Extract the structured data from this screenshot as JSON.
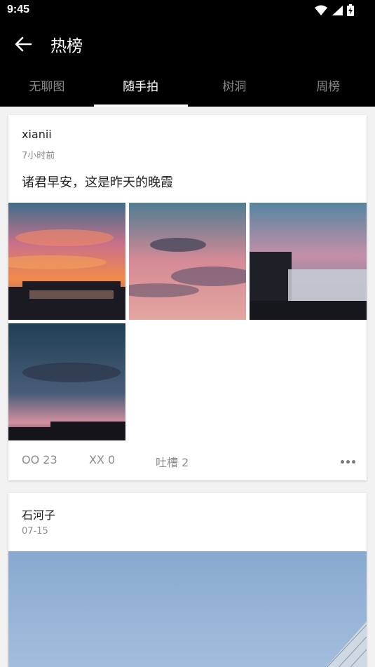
{
  "status": {
    "time": "9:45"
  },
  "appbar": {
    "title": "热榜"
  },
  "tabs": [
    {
      "label": "无聊图"
    },
    {
      "label": "随手拍"
    },
    {
      "label": "树洞"
    },
    {
      "label": "周榜"
    }
  ],
  "posts": [
    {
      "author": "xianii",
      "time": "7小时前",
      "content": "诸君早安，这是昨天的晚霞",
      "oo": "OO 23",
      "xx": "XX 0",
      "comments": "吐槽 2"
    },
    {
      "author": "石河子",
      "time": "07-15"
    }
  ]
}
